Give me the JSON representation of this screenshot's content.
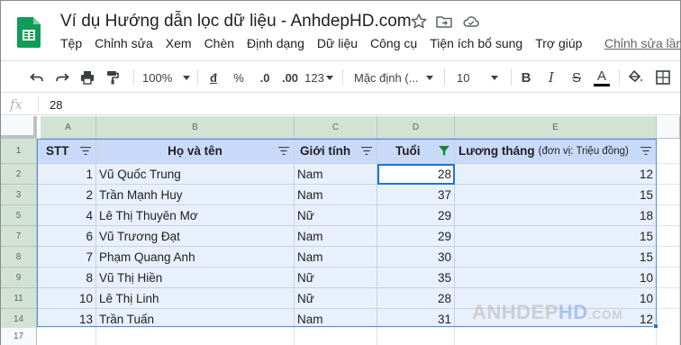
{
  "app": {
    "title": "Ví dụ Hướng dẫn lọc dữ liệu - AnhdepHD.com"
  },
  "menu": {
    "items": [
      "Tệp",
      "Chỉnh sửa",
      "Xem",
      "Chèn",
      "Định dạng",
      "Dữ liệu",
      "Công cụ",
      "Tiện ích bổ sung",
      "Trợ giúp"
    ],
    "last_edit": "Chỉnh sửa lần"
  },
  "toolbar": {
    "zoom": "100%",
    "currency": "đ",
    "percent": "%",
    "dec_decrease": ".0",
    "dec_increase": ".00",
    "more_formats": "123",
    "font": "Mặc định (...",
    "font_size": "10",
    "bold": "B",
    "italic": "I",
    "strike": "S",
    "text_color": "A"
  },
  "formula_bar": {
    "fx": "fx",
    "value": "28"
  },
  "columns": [
    "A",
    "B",
    "C",
    "D",
    "E"
  ],
  "header_row": {
    "row_number": "1",
    "stt": "STT",
    "name": "Họ và tên",
    "gender": "Giới tính",
    "age": "Tuổi",
    "salary": "Lương tháng",
    "salary_unit": "(đơn vị: Triệu đồng)"
  },
  "rows": [
    {
      "row_number": "2",
      "stt": "1",
      "name": "Vũ Quốc Trung",
      "gender": "Nam",
      "age": "28",
      "salary": "12"
    },
    {
      "row_number": "3",
      "stt": "2",
      "name": "Trần Mạnh Huy",
      "gender": "Nam",
      "age": "37",
      "salary": "15"
    },
    {
      "row_number": "5",
      "stt": "4",
      "name": "Lê Thị Thuyên Mơ",
      "gender": "Nữ",
      "age": "29",
      "salary": "18"
    },
    {
      "row_number": "7",
      "stt": "6",
      "name": "Vũ Trương Đạt",
      "gender": "Nam",
      "age": "29",
      "salary": "15"
    },
    {
      "row_number": "8",
      "stt": "7",
      "name": "Phạm Quang Anh",
      "gender": "Nam",
      "age": "30",
      "salary": "15"
    },
    {
      "row_number": "9",
      "stt": "8",
      "name": "Vũ Thị Hiền",
      "gender": "Nữ",
      "age": "35",
      "salary": "10"
    },
    {
      "row_number": "11",
      "stt": "10",
      "name": "Lê Thị Linh",
      "gender": "Nữ",
      "age": "28",
      "salary": "10"
    },
    {
      "row_number": "14",
      "stt": "13",
      "name": "Trần Tuấn",
      "gender": "Nam",
      "age": "31",
      "salary": "12"
    }
  ],
  "empty_row_number": "17",
  "watermark": {
    "part1": "ANHDEP",
    "part2": "HD",
    "part3": ".COM"
  },
  "colors": {
    "header_fill": "#c9daf8",
    "row_fill": "#e8f0fb",
    "selection": "#1a73e8",
    "sheets_green": "#0f9d58",
    "filter_active": "#188038"
  }
}
